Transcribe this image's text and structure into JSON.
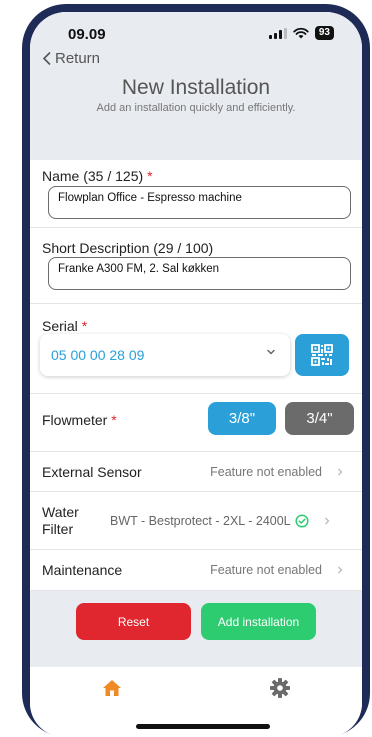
{
  "status": {
    "time": "09.09",
    "battery": "93"
  },
  "header": {
    "back_label": "Return",
    "title": "New Installation",
    "subtitle": "Add an installation quickly and efficiently."
  },
  "form": {
    "name_label": "Name (35 / 125)",
    "name_required": "*",
    "name_value": "Flowplan Office -  Espresso machine",
    "desc_label": "Short Description (29 / 100)",
    "desc_value": "Franke A300 FM, 2. Sal køkken",
    "serial_label": "Serial",
    "serial_required": "*",
    "serial_value": "05 00 00 28 09",
    "flowmeter_label": "Flowmeter",
    "flowmeter_required": "*",
    "flowmeter_options": [
      "3/8\"",
      "3/4\""
    ],
    "flowmeter_selected": "3/8\""
  },
  "rows": {
    "external_sensor_label": "External Sensor",
    "external_sensor_value": "Feature not enabled",
    "water_filter_label": "Water Filter",
    "water_filter_value": "BWT - Bestprotect - 2XL - 2400L",
    "maintenance_label": "Maintenance",
    "maintenance_value": "Feature not enabled"
  },
  "actions": {
    "reset_label": "Reset",
    "add_label": "Add installation"
  },
  "tabs": {
    "items": [
      "home-icon",
      "gear-icon"
    ],
    "active": "home-icon"
  },
  "colors": {
    "accent_blue": "#2a9fd8",
    "reset_red": "#e0262f",
    "add_green": "#2ecc71",
    "home_orange": "#f08a24",
    "inactive_gray": "#6b6b6b",
    "check_green": "#2ecc71",
    "frame_navy": "#1e2b57"
  }
}
